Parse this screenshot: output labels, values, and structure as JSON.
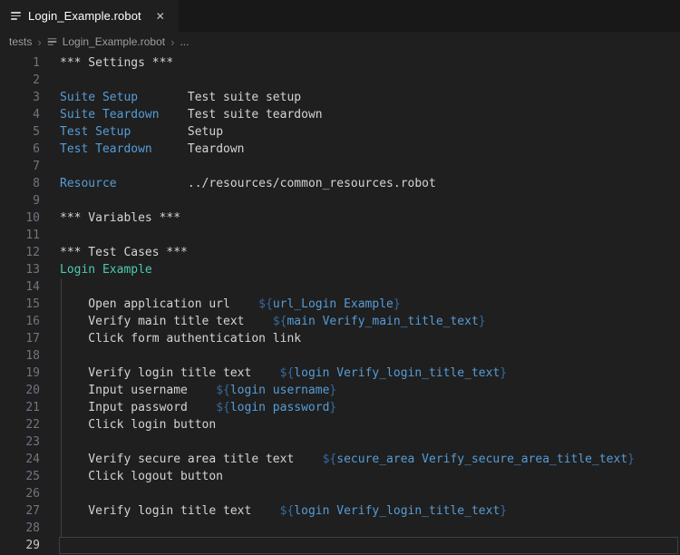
{
  "tab": {
    "title": "Login_Example.robot",
    "close_glyph": "✕"
  },
  "breadcrumb": {
    "separator": "›",
    "items": [
      "tests",
      "Login_Example.robot",
      "..."
    ]
  },
  "colors": {
    "editor_bg": "#1f1f1f",
    "tabstrip_bg": "#181818",
    "setting_keyword": "#569cd6",
    "testcase_name": "#4ec9b0",
    "variable_delim": "#36699e",
    "variable_name": "#569cd6",
    "plain_text": "#d4d4d4",
    "line_number": "#6e7681",
    "line_number_active": "#c6c6c6",
    "indent_guide": "#404040",
    "current_line_border": "#3f4042"
  },
  "editor": {
    "language": "robotframework",
    "lines": [
      {
        "n": 1,
        "s": [
          [
            "h",
            "*** Settings ***"
          ]
        ]
      },
      {
        "n": 2,
        "s": []
      },
      {
        "n": 3,
        "s": [
          [
            "k",
            "Suite Setup"
          ],
          [
            "p",
            "       Test suite setup"
          ]
        ]
      },
      {
        "n": 4,
        "s": [
          [
            "k",
            "Suite Teardown"
          ],
          [
            "p",
            "    Test suite teardown"
          ]
        ]
      },
      {
        "n": 5,
        "s": [
          [
            "k",
            "Test Setup"
          ],
          [
            "p",
            "        Setup"
          ]
        ]
      },
      {
        "n": 6,
        "s": [
          [
            "k",
            "Test Teardown"
          ],
          [
            "p",
            "     Teardown"
          ]
        ]
      },
      {
        "n": 7,
        "s": []
      },
      {
        "n": 8,
        "s": [
          [
            "k",
            "Resource"
          ],
          [
            "p",
            "          ../resources/common_resources.robot"
          ]
        ]
      },
      {
        "n": 9,
        "s": []
      },
      {
        "n": 10,
        "s": [
          [
            "h",
            "*** Variables ***"
          ]
        ]
      },
      {
        "n": 11,
        "s": []
      },
      {
        "n": 12,
        "s": [
          [
            "h",
            "*** Test Cases ***"
          ]
        ]
      },
      {
        "n": 13,
        "s": [
          [
            "t",
            "Login Example"
          ]
        ]
      },
      {
        "n": 14,
        "g": true,
        "s": []
      },
      {
        "n": 15,
        "g": true,
        "s": [
          [
            "p",
            "    Open application url    "
          ],
          [
            "d",
            "${"
          ],
          [
            "v",
            "url_Login Example"
          ],
          [
            "d",
            "}"
          ]
        ]
      },
      {
        "n": 16,
        "g": true,
        "s": [
          [
            "p",
            "    Verify main title text    "
          ],
          [
            "d",
            "${"
          ],
          [
            "v",
            "main Verify_main_title_text"
          ],
          [
            "d",
            "}"
          ]
        ]
      },
      {
        "n": 17,
        "g": true,
        "s": [
          [
            "p",
            "    Click form authentication link"
          ]
        ]
      },
      {
        "n": 18,
        "g": true,
        "s": []
      },
      {
        "n": 19,
        "g": true,
        "s": [
          [
            "p",
            "    Verify login title text    "
          ],
          [
            "d",
            "${"
          ],
          [
            "v",
            "login Verify_login_title_text"
          ],
          [
            "d",
            "}"
          ]
        ]
      },
      {
        "n": 20,
        "g": true,
        "s": [
          [
            "p",
            "    Input username    "
          ],
          [
            "d",
            "${"
          ],
          [
            "v",
            "login username"
          ],
          [
            "d",
            "}"
          ]
        ]
      },
      {
        "n": 21,
        "g": true,
        "s": [
          [
            "p",
            "    Input password    "
          ],
          [
            "d",
            "${"
          ],
          [
            "v",
            "login password"
          ],
          [
            "d",
            "}"
          ]
        ]
      },
      {
        "n": 22,
        "g": true,
        "s": [
          [
            "p",
            "    Click login button"
          ]
        ]
      },
      {
        "n": 23,
        "g": true,
        "s": []
      },
      {
        "n": 24,
        "g": true,
        "s": [
          [
            "p",
            "    Verify secure area title text    "
          ],
          [
            "d",
            "${"
          ],
          [
            "v",
            "secure_area Verify_secure_area_title_text"
          ],
          [
            "d",
            "}"
          ]
        ]
      },
      {
        "n": 25,
        "g": true,
        "s": [
          [
            "p",
            "    Click logout button"
          ]
        ]
      },
      {
        "n": 26,
        "g": true,
        "s": []
      },
      {
        "n": 27,
        "g": true,
        "s": [
          [
            "p",
            "    Verify login title text    "
          ],
          [
            "d",
            "${"
          ],
          [
            "v",
            "login Verify_login_title_text"
          ],
          [
            "d",
            "}"
          ]
        ]
      },
      {
        "n": 28,
        "g": true,
        "s": []
      },
      {
        "n": 29,
        "cur": true,
        "s": []
      }
    ]
  }
}
